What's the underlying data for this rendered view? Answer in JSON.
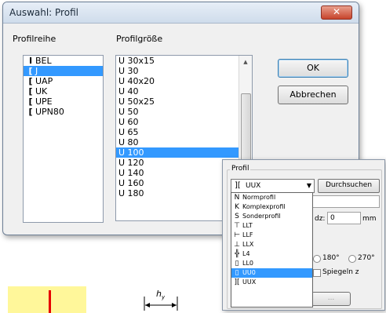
{
  "dialog": {
    "title": "Auswahl: Profil",
    "close_label": "✕",
    "series_label": "Profilreihe",
    "size_label": "Profilgröße",
    "series": [
      {
        "icon": "I",
        "label": "BEL",
        "selected": false
      },
      {
        "icon": "[",
        "label": "J",
        "selected": true
      },
      {
        "icon": "[",
        "label": "UAP",
        "selected": false
      },
      {
        "icon": "[",
        "label": "UK",
        "selected": false
      },
      {
        "icon": "[",
        "label": "UPE",
        "selected": false
      },
      {
        "icon": "[",
        "label": "UPN80",
        "selected": false
      }
    ],
    "sizes": [
      "U 30x15",
      "U 30",
      "U 40x20",
      "U 40",
      "U 50x25",
      "U 50",
      "U 60",
      "U 65",
      "U 80",
      "U 100",
      "U 120",
      "U 140",
      "U 160",
      "U 180"
    ],
    "selected_size_index": 9,
    "ok_label": "OK",
    "cancel_label": "Abbrechen"
  },
  "subdialog": {
    "group_label": "Profil",
    "combo_value": "UUX",
    "browse_label": "Durchsuchen",
    "dz_label": "dz:",
    "dz_value": "0",
    "unit": "mm",
    "radio_180": "180°",
    "radio_270": "270°",
    "mirror_label": "Spiegeln z",
    "button_dots": "...",
    "dropdown": [
      {
        "key": "N",
        "label": "Normprofil"
      },
      {
        "key": "K",
        "label": "Komplexprofil"
      },
      {
        "key": "S",
        "label": "Sonderprofil"
      },
      {
        "key": "⊤",
        "label": "LLT"
      },
      {
        "key": "⊢",
        "label": "LLF"
      },
      {
        "key": "⊥",
        "label": "LLX"
      },
      {
        "key": "╬",
        "label": "L4"
      },
      {
        "key": "▯",
        "label": "LL0"
      },
      {
        "key": "▯",
        "label": "UU0"
      },
      {
        "key": "][",
        "label": "UUX"
      }
    ],
    "dropdown_selected_index": 8
  },
  "bottom": {
    "dim_label": "h",
    "dim_sub": "y"
  }
}
